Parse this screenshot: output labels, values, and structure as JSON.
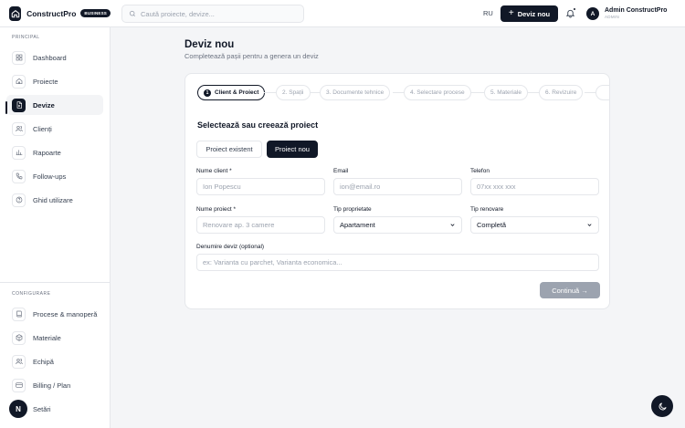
{
  "app": {
    "name": "ConstructPro",
    "badge": "BUSINESS"
  },
  "header": {
    "search_placeholder": "Caută proiecte, devize...",
    "lang": "RU",
    "new_button": "Deviz nou",
    "user_initial": "A",
    "user_name": "Admin ConstructPro",
    "user_role": "ADMIN"
  },
  "sidebar": {
    "section_main": "PRINCIPAL",
    "main_items": [
      {
        "label": "Dashboard",
        "icon": "grid-icon"
      },
      {
        "label": "Proiecte",
        "icon": "home-icon"
      },
      {
        "label": "Devize",
        "icon": "document-icon",
        "active": true
      },
      {
        "label": "Clienți",
        "icon": "users-icon"
      },
      {
        "label": "Rapoarte",
        "icon": "bar-chart-icon"
      },
      {
        "label": "Follow-ups",
        "icon": "phone-icon"
      },
      {
        "label": "Ghid utilizare",
        "icon": "help-circle-icon"
      }
    ],
    "section_config": "CONFIGURARE",
    "config_items": [
      {
        "label": "Procese & manoperă",
        "icon": "book-icon"
      },
      {
        "label": "Materiale",
        "icon": "box-icon"
      },
      {
        "label": "Echipă",
        "icon": "team-icon"
      },
      {
        "label": "Billing / Plan",
        "icon": "credit-card-icon"
      },
      {
        "label": "Setări",
        "icon": "settings-icon"
      }
    ],
    "footer_logo": "N"
  },
  "main": {
    "title": "Deviz nou",
    "subtitle": "Completează pașii pentru a genera un deviz",
    "steps": [
      {
        "num": "1",
        "label": "Client & Proiect"
      },
      {
        "label": "2. Spații"
      },
      {
        "label": "3. Documente tehnice"
      },
      {
        "label": "4. Selectare procese"
      },
      {
        "label": "5. Materiale"
      },
      {
        "label": "6. Revizuire"
      }
    ],
    "form_title": "Selectează sau creează proiect",
    "toggle_existing": "Proiect existent",
    "toggle_new": "Proiect nou",
    "fields": {
      "client_name": {
        "label": "Nume client *",
        "placeholder": "Ion Popescu"
      },
      "email": {
        "label": "Email",
        "placeholder": "ion@email.ro"
      },
      "phone": {
        "label": "Telefon",
        "placeholder": "07xx xxx xxx"
      },
      "project_name": {
        "label": "Nume proiect *",
        "placeholder": "Renovare ap. 3 camere"
      },
      "property_type": {
        "label": "Tip proprietate",
        "value": "Apartament"
      },
      "renovation_type": {
        "label": "Tip renovare",
        "value": "Completă"
      },
      "estimate_name": {
        "label": "Denumire deviz (optional)",
        "placeholder": "ex: Varianta cu parchet, Varianta economica..."
      }
    },
    "continue_button": "Continuă →"
  }
}
